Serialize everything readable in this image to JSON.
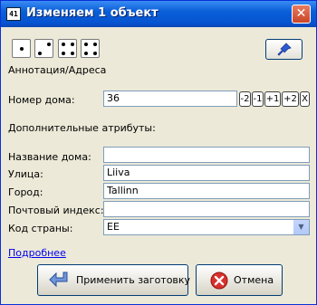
{
  "window": {
    "title": "Изменяем 1 объект",
    "icon_text": "41"
  },
  "preset": {
    "category": "Аннотация/Адреса",
    "house_number_label": "Номер дома:",
    "house_number_value": "36",
    "step_buttons": [
      "-2",
      "-1",
      "+1",
      "+2",
      "X"
    ],
    "extra_attrs_label": "Дополнительные атрибуты:"
  },
  "fields": [
    {
      "label": "Название дома:",
      "value": ""
    },
    {
      "label": "Улица:",
      "value": "Liiva"
    },
    {
      "label": "Город:",
      "value": "Tallinn"
    },
    {
      "label": "Почтовый индекс:",
      "value": ""
    }
  ],
  "country": {
    "label": "Код страны:",
    "value": "EE"
  },
  "more_link": "Подробнее",
  "buttons": {
    "apply": "Применить заготовку",
    "cancel": "Отмена"
  },
  "colors": {
    "titlebar": "#0a5fd8",
    "window_bg": "#ece9d8",
    "link": "#0000ee"
  }
}
